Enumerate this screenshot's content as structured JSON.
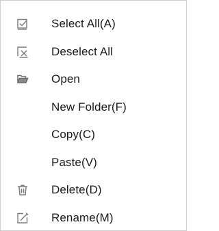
{
  "context_menu": {
    "items": [
      {
        "label": "Select All(A)",
        "icon": "select-all-icon"
      },
      {
        "label": "Deselect All",
        "icon": "deselect-all-icon"
      },
      {
        "label": "Open",
        "icon": "open-folder-icon"
      },
      {
        "label": "New Folder(F)",
        "icon": ""
      },
      {
        "label": "Copy(C)",
        "icon": ""
      },
      {
        "label": "Paste(V)",
        "icon": ""
      },
      {
        "label": "Delete(D)",
        "icon": "trash-icon"
      },
      {
        "label": "Rename(M)",
        "icon": "rename-icon"
      }
    ],
    "icon_color": "#7a7a7a",
    "text_color": "#1a1a1a",
    "border_color": "#cfcfcf"
  }
}
